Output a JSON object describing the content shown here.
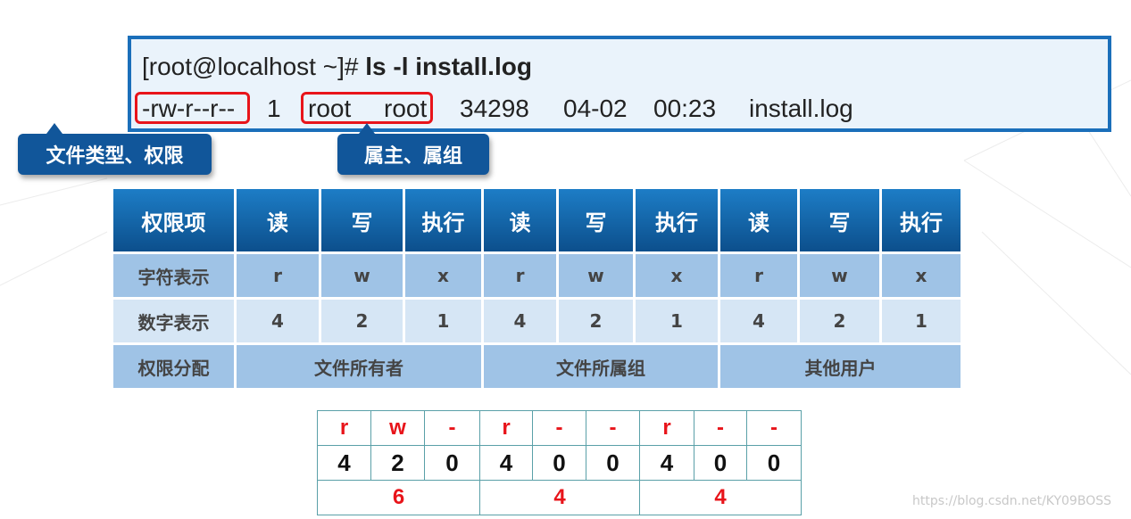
{
  "terminal": {
    "prompt": "[root@localhost ~]# ",
    "command": "ls -l install.log",
    "output": {
      "perms": "-rw-r--r--",
      "links": "1",
      "owner": "root",
      "group": "root",
      "size": "34298",
      "date": "04-02",
      "time": "00:23",
      "filename": "install.log"
    }
  },
  "callouts": {
    "type_perms": "文件类型、权限",
    "owner_group": "属主、属组"
  },
  "perm_table": {
    "header": [
      "权限项",
      "读",
      "写",
      "执行",
      "读",
      "写",
      "执行",
      "读",
      "写",
      "执行"
    ],
    "char_row": [
      "字符表示",
      "r",
      "w",
      "x",
      "r",
      "w",
      "x",
      "r",
      "w",
      "x"
    ],
    "num_row": [
      "数字表示",
      "4",
      "2",
      "1",
      "4",
      "2",
      "1",
      "4",
      "2",
      "1"
    ],
    "assign_row": {
      "label": "权限分配",
      "groups": [
        "文件所有者",
        "文件所属组",
        "其他用户"
      ]
    }
  },
  "bit_table": {
    "letters": [
      "r",
      "w",
      "-",
      "r",
      "-",
      "-",
      "r",
      "-",
      "-"
    ],
    "digits": [
      "4",
      "2",
      "0",
      "4",
      "0",
      "0",
      "4",
      "0",
      "0"
    ],
    "sums": [
      "6",
      "4",
      "4"
    ]
  },
  "colors": {
    "accent_blue": "#1b6fba",
    "highlight_red": "#e8141a",
    "header_dark": "#0c4f8c"
  },
  "watermark": "https://blog.csdn.net/KY09BOSS"
}
